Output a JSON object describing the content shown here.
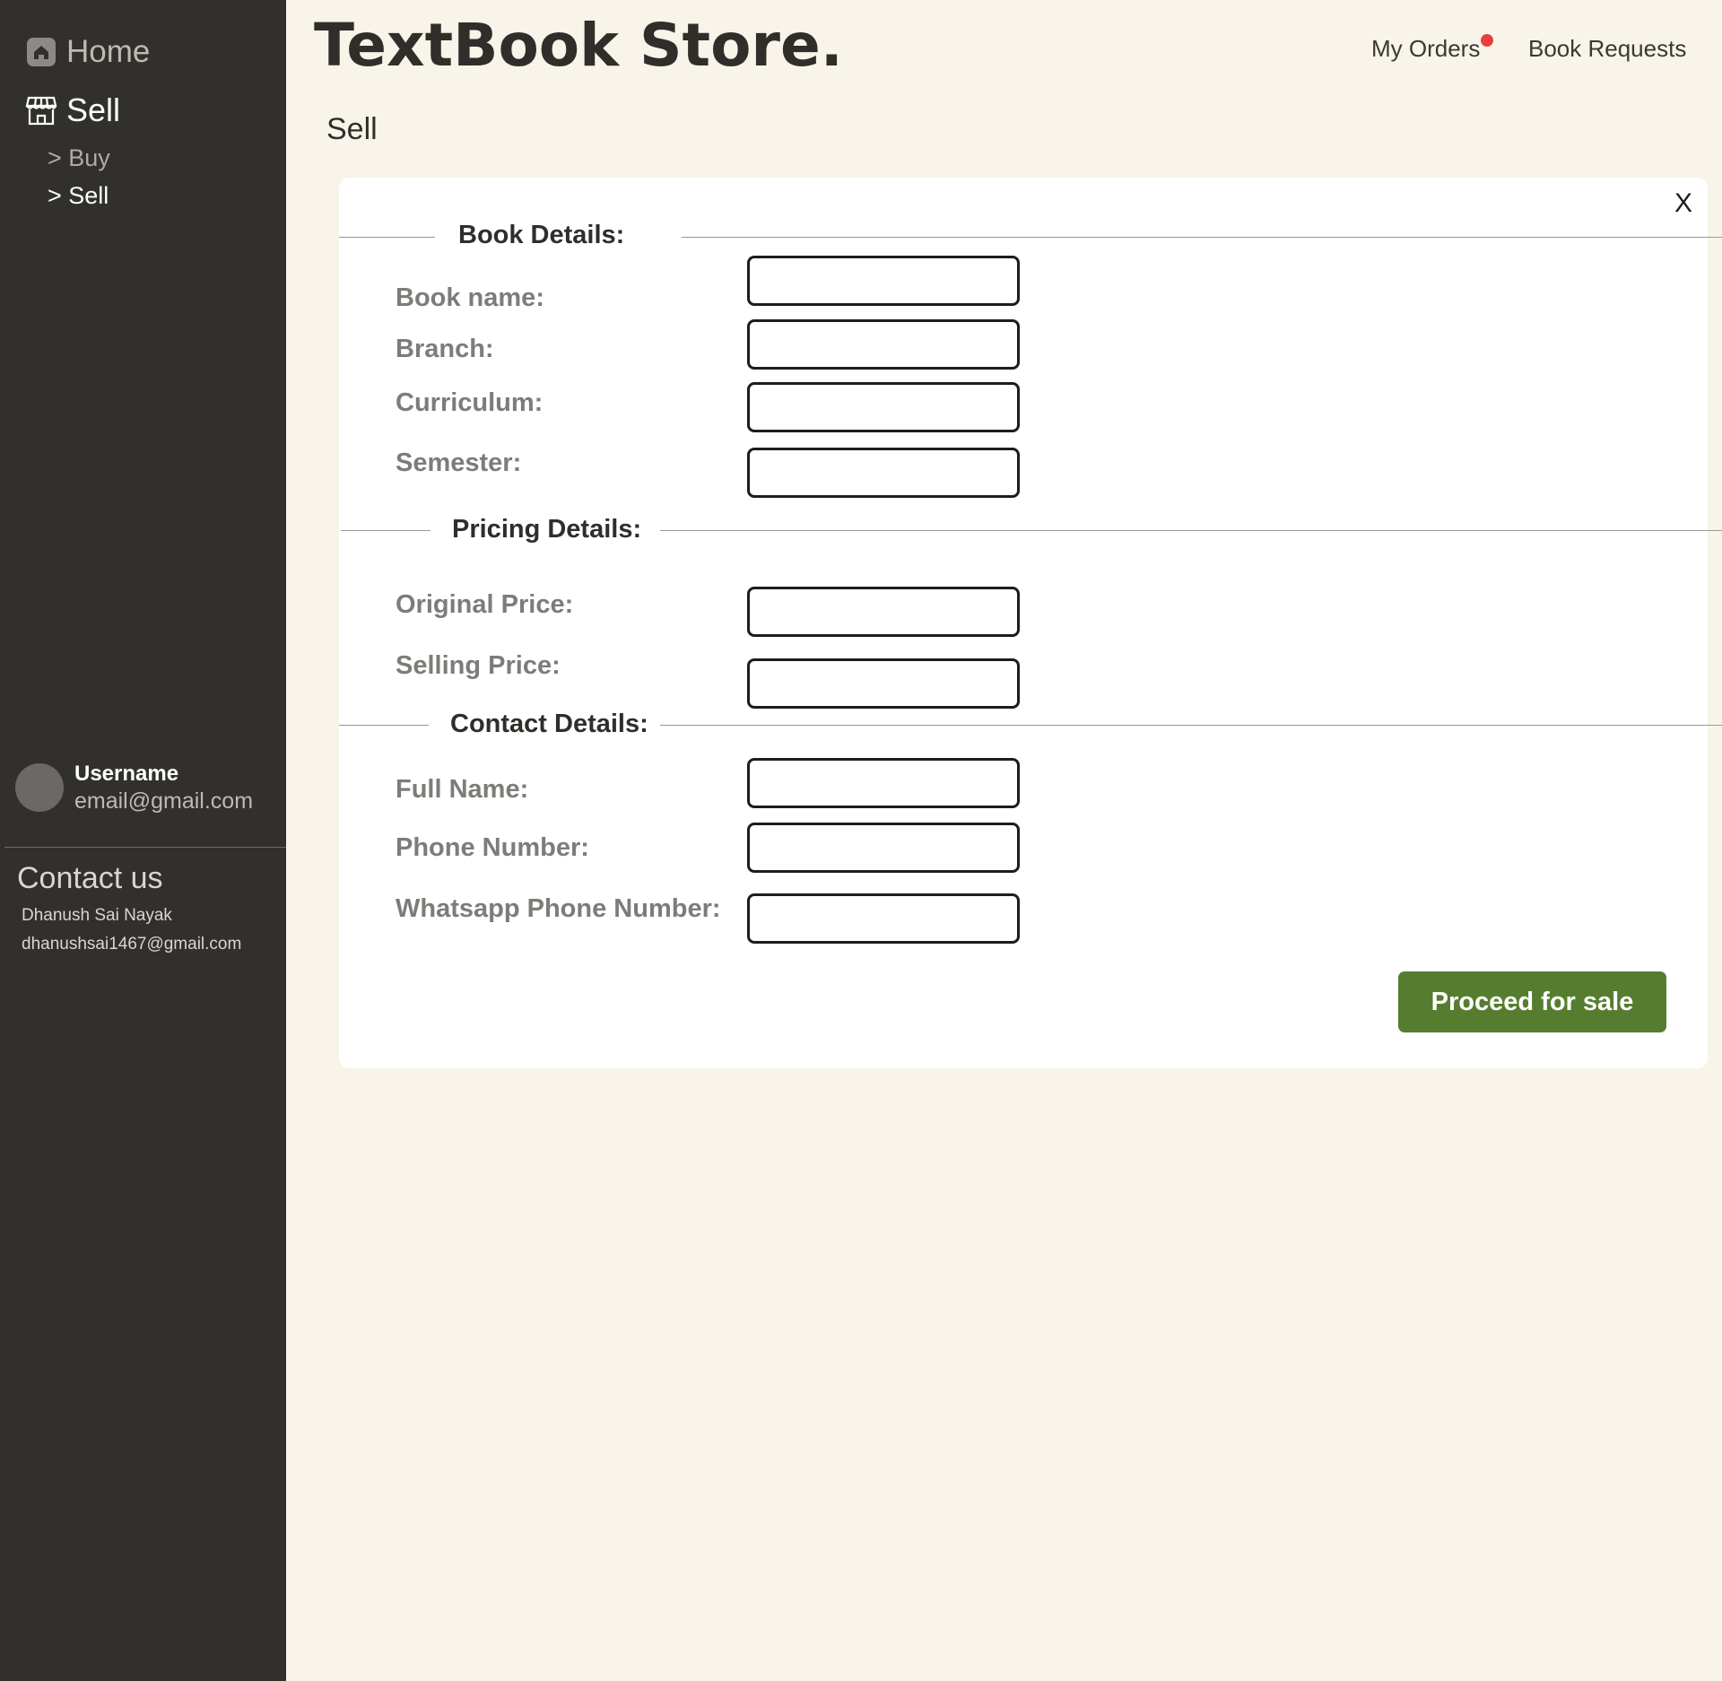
{
  "app": {
    "title": "TextBook Store."
  },
  "sidebar": {
    "home_label": "Home",
    "sell_label": "Sell",
    "sub_items": [
      "> Buy",
      "> Sell"
    ],
    "user": {
      "name": "Username",
      "email": "email@gmail.com"
    },
    "contact": {
      "title": "Contact us",
      "name": "Dhanush Sai Nayak",
      "email": "dhanushsai1467@gmail.com"
    }
  },
  "header": {
    "my_orders": "My Orders",
    "book_requests": "Book Requests",
    "notification_color": "#e8403f"
  },
  "page": {
    "heading": "Sell"
  },
  "form": {
    "close_label": "X",
    "sections": {
      "book": "Book Details:",
      "pricing": "Pricing Details:",
      "contact": "Contact Details:"
    },
    "fields": {
      "book_name": {
        "label": "Book name:",
        "value": ""
      },
      "branch": {
        "label": "Branch:",
        "value": ""
      },
      "curriculum": {
        "label": "Curriculum:",
        "value": ""
      },
      "semester": {
        "label": "Semester:",
        "value": ""
      },
      "original_price": {
        "label": "Original Price:",
        "value": ""
      },
      "selling_price": {
        "label": "Selling Price:",
        "value": ""
      },
      "full_name": {
        "label": "Full Name:",
        "value": ""
      },
      "phone_number": {
        "label": "Phone Number:",
        "value": ""
      },
      "whatsapp_number": {
        "label": "Whatsapp Phone Number:",
        "value": ""
      }
    },
    "submit_label": "Proceed for sale",
    "submit_color": "#567d2f"
  }
}
